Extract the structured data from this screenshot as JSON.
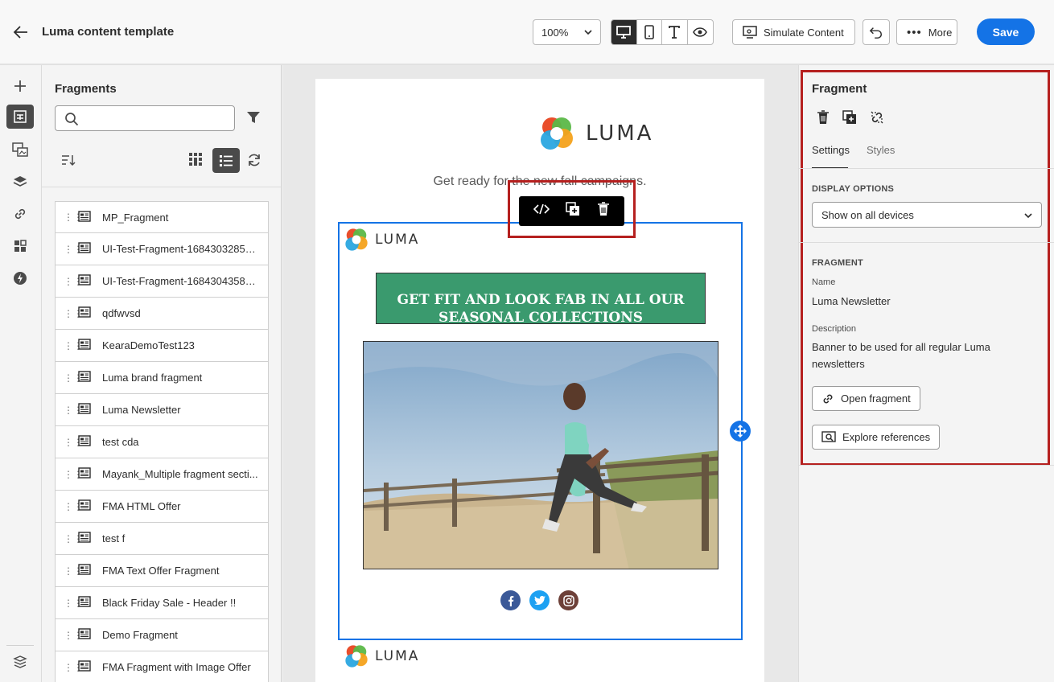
{
  "header": {
    "title": "Luma content template",
    "zoom": "100%",
    "simulate_label": "Simulate Content",
    "more_label": "More",
    "save_label": "Save"
  },
  "fragments_panel": {
    "title": "Fragments",
    "search_placeholder": "",
    "items": [
      {
        "label": "MP_Fragment"
      },
      {
        "label": "UI-Test-Fragment-168430328546..."
      },
      {
        "label": "UI-Test-Fragment-168430435899..."
      },
      {
        "label": "qdfwvsd"
      },
      {
        "label": "KearaDemoTest123"
      },
      {
        "label": "Luma brand fragment"
      },
      {
        "label": "Luma Newsletter"
      },
      {
        "label": "test cda"
      },
      {
        "label": "Mayank_Multiple fragment secti..."
      },
      {
        "label": "FMA HTML Offer"
      },
      {
        "label": "test f"
      },
      {
        "label": "FMA Text Offer Fragment"
      },
      {
        "label": "Black Friday Sale - Header !!"
      },
      {
        "label": "Demo Fragment"
      },
      {
        "label": "FMA Fragment with Image Offer"
      }
    ]
  },
  "canvas": {
    "brand": "LUMA",
    "tagline": "Get ready for the new fall campaigns.",
    "banner_text": "GET FIT AND LOOK FAB IN ALL OUR SEASONAL COLLECTIONS",
    "social_colors": {
      "facebook": "#3b5998",
      "twitter": "#1da1f2",
      "instagram": "#6d4038"
    }
  },
  "right_panel": {
    "title": "Fragment",
    "tabs": [
      "Settings",
      "Styles"
    ],
    "display_options_label": "DISPLAY OPTIONS",
    "display_option_value": "Show on all devices",
    "fragment_section_label": "FRAGMENT",
    "name_label": "Name",
    "name_value": "Luma Newsletter",
    "description_label": "Description",
    "description_value": "Banner to be used for all regular Luma newsletters",
    "open_fragment_label": "Open fragment",
    "explore_references_label": "Explore references"
  },
  "colors": {
    "accent": "#1473e6",
    "highlight": "#b5201f",
    "banner": "#3a9a6e"
  }
}
